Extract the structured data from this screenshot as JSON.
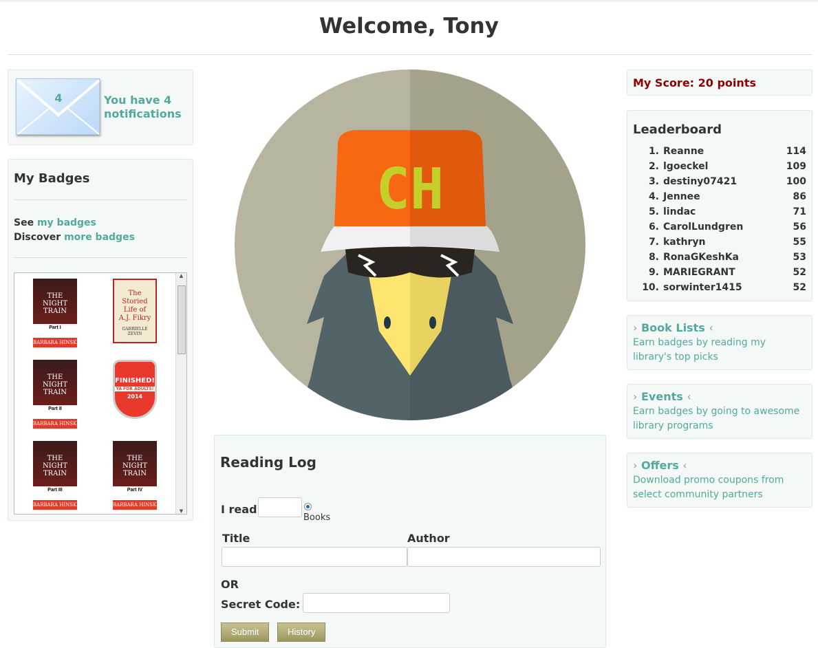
{
  "header": {
    "title": "Welcome, Tony"
  },
  "notifications": {
    "count": "4",
    "text": "You have 4 notifications"
  },
  "badges": {
    "title": "My Badges",
    "see_prefix": "See",
    "see_link": "my badges",
    "discover_prefix": "Discover",
    "discover_link": "more badges",
    "items": [
      {
        "title": "THE NIGHT TRAIN",
        "part": "Part I",
        "author": "BARBARA HINSKE"
      },
      {
        "title": "The Storied Life of A.J. Fikry",
        "author": "GABRIELLE ZEVIN"
      },
      {
        "title": "THE NIGHT TRAIN",
        "part": "Part II",
        "author": "BARBARA HINSKE"
      },
      {
        "title": "FINISHED!",
        "subtitle": "YA FOR ADULTS!",
        "year": "2014"
      },
      {
        "title": "THE NIGHT TRAIN",
        "part": "Part III",
        "author": "BARBARA HINSKE"
      },
      {
        "title": "THE NIGHT TRAIN",
        "part": "Part IV",
        "author": "BARBARA HINSKE"
      }
    ]
  },
  "avatar": {
    "cap_text": "CH"
  },
  "reading_log": {
    "title": "Reading Log",
    "i_read": "I read",
    "unit": "Books",
    "title_label": "Title",
    "author_label": "Author",
    "or": "OR",
    "secret_code": "Secret Code:",
    "submit": "Submit",
    "history": "History"
  },
  "score": {
    "text": "My Score: 20 points"
  },
  "leaderboard": {
    "title": "Leaderboard",
    "rows": [
      {
        "rank": "1.",
        "name": "Reanne",
        "score": "114"
      },
      {
        "rank": "2.",
        "name": "lgoeckel",
        "score": "109"
      },
      {
        "rank": "3.",
        "name": "destiny07421",
        "score": "100"
      },
      {
        "rank": "4.",
        "name": "Jennee",
        "score": "86"
      },
      {
        "rank": "5.",
        "name": "lindac",
        "score": "71"
      },
      {
        "rank": "6.",
        "name": "CarolLundgren",
        "score": "56"
      },
      {
        "rank": "7.",
        "name": "kathryn",
        "score": "55"
      },
      {
        "rank": "8.",
        "name": "RonaGKeshKa",
        "score": "53"
      },
      {
        "rank": "9.",
        "name": "MARIEGRANT",
        "score": "52"
      },
      {
        "rank": "10.",
        "name": "sorwinter1415",
        "score": "52"
      }
    ]
  },
  "sections": [
    {
      "title": "Book Lists",
      "desc": "Earn badges by reading my library's top picks"
    },
    {
      "title": "Events",
      "desc": "Earn badges by going to awesome library programs"
    },
    {
      "title": "Offers",
      "desc": "Download promo coupons from select community partners"
    }
  ]
}
